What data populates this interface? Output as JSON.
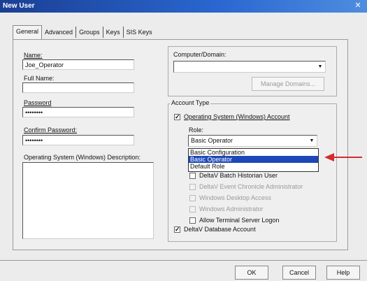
{
  "window": {
    "title": "New User"
  },
  "tabs": [
    {
      "label": "General"
    },
    {
      "label": "Advanced"
    },
    {
      "label": "Groups"
    },
    {
      "label": "Keys"
    },
    {
      "label": "SIS Keys"
    }
  ],
  "general": {
    "name_label": "Name:",
    "name_value": "Joe_Operator",
    "full_name_label": "Full Name:",
    "full_name_value": "",
    "password_label": "Password",
    "password_value": "••••••••",
    "confirm_label": "Confirm Password:",
    "confirm_value": "••••••••",
    "desc_label": "Operating System (Windows) Description:",
    "desc_value": ""
  },
  "computer": {
    "label": "Computer/Domain:",
    "value": "",
    "manage_label": "Manage Domains..."
  },
  "account_type": {
    "title": "Account Type",
    "os_account_label": "Operating System (Windows) Account",
    "role_label": "Role:",
    "role_selected": "Basic Operator",
    "role_options": [
      "Basic Configuration",
      "Basic Operator",
      "Default Role"
    ],
    "checkboxes": [
      {
        "label": "DeltaV Batch Historian User",
        "checked": false,
        "enabled": true
      },
      {
        "label": "DeltaV Event Chronicle Administrator",
        "checked": false,
        "enabled": false
      },
      {
        "label": "Windows Desktop Access",
        "checked": false,
        "enabled": false
      },
      {
        "label": "Windows Administrator",
        "checked": false,
        "enabled": false
      },
      {
        "label": "Allow Terminal Server Logon",
        "checked": false,
        "enabled": true
      }
    ],
    "db_account_label": "DeltaV Database Account"
  },
  "buttons": {
    "ok": "OK",
    "cancel": "Cancel",
    "help": "Help"
  },
  "colors": {
    "arrow": "#d42c2c",
    "selection": "#1d48b8",
    "titlebar": "#1a3f94"
  }
}
